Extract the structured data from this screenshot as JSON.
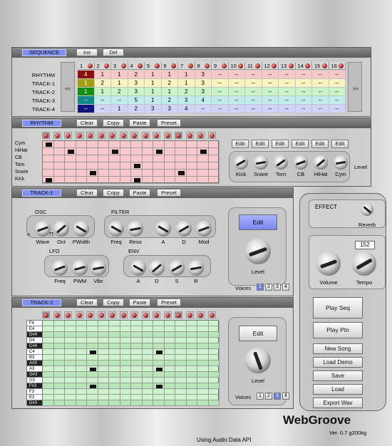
{
  "app": {
    "title": "WebGroove",
    "version": "Ver. 0.7 g200kg",
    "footer": "Using Audio Data API"
  },
  "sequence": {
    "tag": "SEQUENCE",
    "ins": "Ins",
    "del": "Del",
    "prev": "<<",
    "next": ">>",
    "columns": [
      "1",
      "2",
      "3",
      "4",
      "5",
      "6",
      "7",
      "8",
      "9",
      "10",
      "11",
      "12",
      "13",
      "14",
      "15",
      "16"
    ],
    "rows": [
      {
        "label": "RHYTHM",
        "cells": [
          "4",
          "1",
          "1",
          "2",
          "1",
          "1",
          "1",
          "3",
          "--",
          "--",
          "--",
          "--",
          "--",
          "--",
          "--",
          "--"
        ],
        "color": "#f8c8c8",
        "first": "#8a1010"
      },
      {
        "label": "TRACK-1",
        "cells": [
          "1",
          "2",
          "1",
          "3",
          "1",
          "2",
          "1",
          "3",
          "--",
          "--",
          "--",
          "--",
          "--",
          "--",
          "--",
          "--"
        ],
        "color": "#f8f4c0",
        "first": "#a0a012"
      },
      {
        "label": "TRACK-2",
        "cells": [
          "1",
          "1",
          "2",
          "3",
          "1",
          "1",
          "2",
          "3",
          "--",
          "--",
          "--",
          "--",
          "--",
          "--",
          "--",
          "--"
        ],
        "color": "#c8f4c8",
        "first": "#129012"
      },
      {
        "label": "TRACK-3",
        "cells": [
          "--",
          "--",
          "--",
          "5",
          "1",
          "2",
          "3",
          "4",
          "--",
          "--",
          "--",
          "--",
          "--",
          "--",
          "--",
          "--"
        ],
        "color": "#c0ecec",
        "first": "#108888"
      },
      {
        "label": "TRACK-4",
        "cells": [
          "--",
          "--",
          "1",
          "2",
          "3",
          "3",
          "4",
          "--",
          "--",
          "--",
          "--",
          "--",
          "--",
          "--",
          "--",
          "--"
        ],
        "color": "#d0d4f8",
        "first": "#141480"
      }
    ]
  },
  "rhythm": {
    "tag": "RHYTHM",
    "clear": "Clear",
    "copy": "Copy",
    "paste": "Paste",
    "preset": "Preset",
    "instruments": [
      "Cym",
      "HiHat",
      "CB",
      "Tom",
      "Snare",
      "Kick"
    ],
    "notes": [
      [
        0,
        0
      ],
      [
        1,
        2
      ],
      [
        1,
        6
      ],
      [
        1,
        10
      ],
      [
        1,
        14
      ],
      [
        3,
        8
      ],
      [
        4,
        4
      ],
      [
        4,
        12
      ],
      [
        5,
        0
      ],
      [
        5,
        8
      ]
    ],
    "edit": "Edit",
    "level": "Level",
    "knobs": [
      "Kick",
      "Snare",
      "Tom",
      "CB",
      "HiHat",
      "Cym"
    ]
  },
  "track1": {
    "tag": "TRACK-1",
    "clear": "Clear",
    "copy": "Copy",
    "paste": "Paste",
    "preset": "Preset",
    "osc": "OSC",
    "osc_knobs": [
      "Wave",
      "Oct",
      "PWidth"
    ],
    "filter": "FILTER",
    "filter_knobs": [
      "Freq",
      "Reso",
      "A",
      "D",
      "Mod"
    ],
    "lfo": "LFO",
    "lfo_knobs": [
      "Freq",
      "PWM",
      "Vibr"
    ],
    "env": "ENV",
    "env_knobs": [
      "A",
      "D",
      "S",
      "R"
    ],
    "edit": "Edit",
    "level": "Level",
    "voices": "Voices",
    "voice_opts": [
      "1",
      "2",
      "3",
      "4"
    ],
    "voice_sel": 1
  },
  "track2": {
    "tag": "TRACK-2",
    "clear": "Clear",
    "copy": "Copy",
    "paste": "Paste",
    "preset": "Preset",
    "keys": [
      "F4",
      "E4",
      "D#4",
      "D4",
      "C#4",
      "C4",
      "B3",
      "A#3",
      "A3",
      "G#3",
      "G3",
      "F#3",
      "F3",
      "E3",
      "D#3"
    ],
    "notes": [
      [
        5,
        4
      ],
      [
        5,
        10
      ],
      [
        8,
        4
      ],
      [
        8,
        10
      ],
      [
        11,
        4
      ],
      [
        11,
        10
      ]
    ],
    "edit": "Edit",
    "level": "Level",
    "voices": "Voices",
    "voice_opts": [
      "1",
      "2",
      "3",
      "4"
    ],
    "voice_sel": 3
  },
  "side": {
    "effect": "EFFECT",
    "reverb": "Reverb",
    "tempo_value": "152",
    "volume": "Volume",
    "tempo": "Tempo",
    "play_seq": "Play Seq",
    "play_ptn": "Play Ptn",
    "new_song": "New Song",
    "load_demo": "Load Demo",
    "save": "Save",
    "load": "Load",
    "export_wav": "Export Wav"
  }
}
